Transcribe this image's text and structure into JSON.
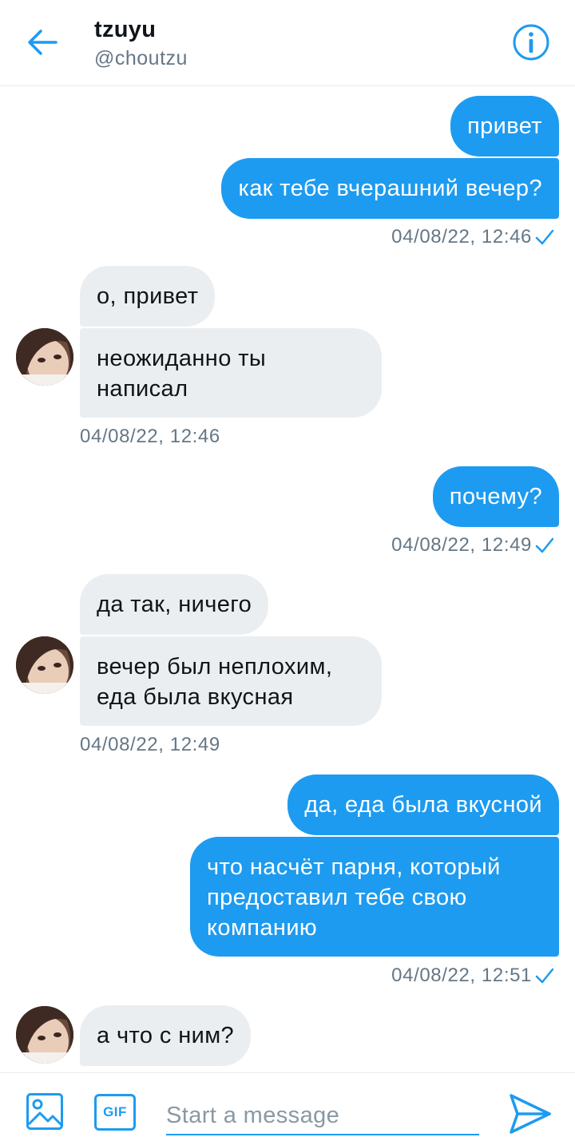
{
  "header": {
    "title": "tzuyu",
    "handle": "@choutzu",
    "back_icon": "arrow-left-icon",
    "info_icon": "info-icon"
  },
  "messages": [
    {
      "direction": "out",
      "text": "привет"
    },
    {
      "direction": "out",
      "text": "как тебе вчерашний вечер?"
    },
    {
      "type": "timestamp",
      "text": "04/08/22, 12:46",
      "read": true
    },
    {
      "direction": "in",
      "text": "о, привет"
    },
    {
      "direction": "in",
      "lines": [
        "неожиданно ты",
        "написал"
      ]
    },
    {
      "type": "timestamp",
      "text": "04/08/22, 12:46"
    },
    {
      "direction": "out",
      "text": "почему?"
    },
    {
      "type": "timestamp",
      "text": "04/08/22, 12:49",
      "read": true
    },
    {
      "direction": "in",
      "text": "да так, ничего"
    },
    {
      "direction": "in",
      "lines": [
        "вечер был неплохим,",
        "еда была вкусная"
      ]
    },
    {
      "type": "timestamp",
      "text": "04/08/22, 12:49"
    },
    {
      "direction": "out",
      "text": "да, еда была вкусной"
    },
    {
      "direction": "out",
      "lines": [
        "что насчёт парня, который",
        "предоставил тебе свою",
        "компанию"
      ]
    },
    {
      "type": "timestamp",
      "text": "04/08/22, 12:51",
      "read": true
    },
    {
      "direction": "in",
      "text": "а что с ним?"
    }
  ],
  "composer": {
    "media_icon": "image-icon",
    "gif_label": "GIF",
    "placeholder": "Start a message",
    "value": "",
    "send_icon": "send-icon"
  },
  "colors": {
    "accent": "#1d9bf0",
    "incoming_bubble": "#ebeef0",
    "muted_text": "#657786"
  }
}
